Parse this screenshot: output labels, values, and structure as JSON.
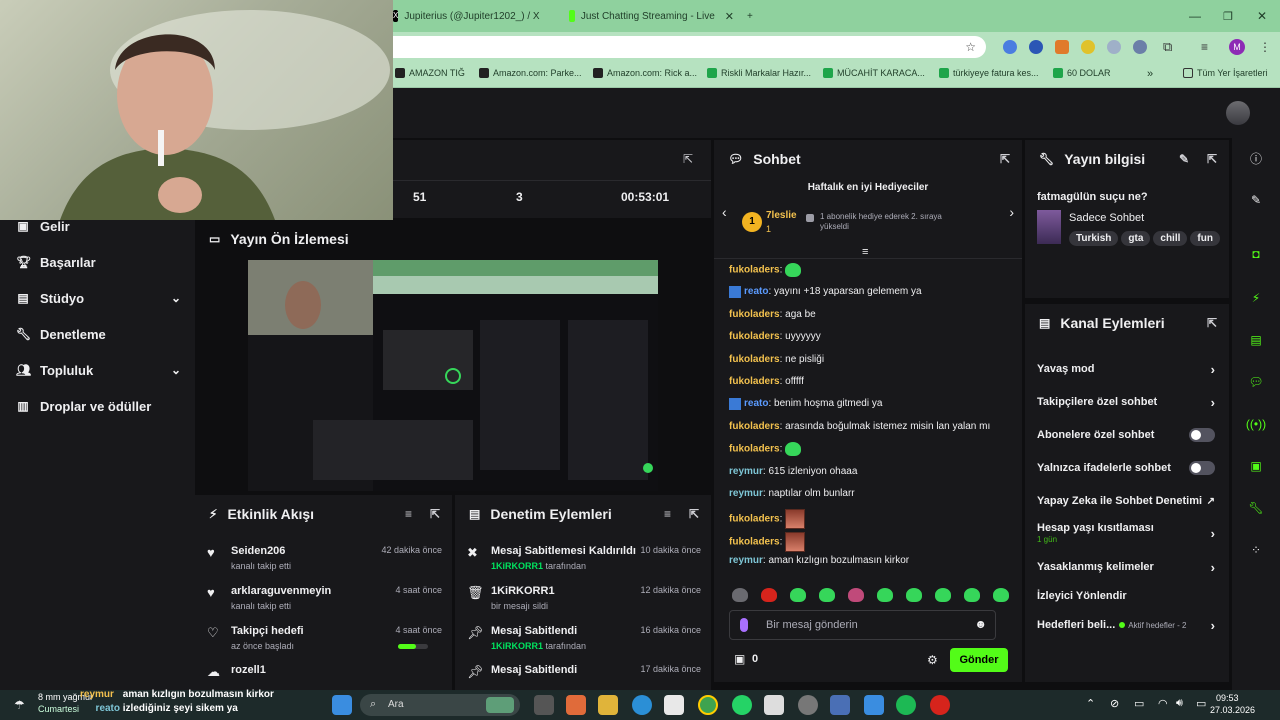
{
  "browser": {
    "tabs": [
      {
        "label": "Jupiterius (@Jupiter1202_) / X",
        "icon": "x-logo-icon"
      },
      {
        "label": "Just Chatting Streaming - Live",
        "icon": "kick-logo-icon"
      }
    ],
    "bookmarks": [
      "AMAZON TIĞ",
      "Amazon.com: Parke...",
      "Amazon.com: Rick a...",
      "Riskli Markalar Hazır...",
      "MÜCAHİT KARACA...",
      "türkiyeye fatura kes...",
      "60 DOLAR"
    ],
    "all_bookmarks_label": "Tüm Yer İşaretleri",
    "profile_letter": "M"
  },
  "sidebar": {
    "items": [
      {
        "label": "Gelir",
        "icon": "revenue-icon"
      },
      {
        "label": "Başarılar",
        "icon": "trophy-icon"
      },
      {
        "label": "Stüdyo",
        "icon": "studio-icon",
        "expandable": true
      },
      {
        "label": "Denetleme",
        "icon": "wrench-icon"
      },
      {
        "label": "Topluluk",
        "icon": "community-icon",
        "expandable": true
      },
      {
        "label": "Droplar ve ödüller",
        "icon": "drops-icon"
      }
    ]
  },
  "stats": {
    "viewers": "51",
    "followers": "3",
    "uptime": "00:53:01"
  },
  "preview": {
    "title": "Yayın Ön İzlemesi"
  },
  "activity": {
    "title": "Etkinlik Akışı",
    "items": [
      {
        "name": "Seiden206",
        "sub": "kanalı takip etti",
        "time": "42 dakika önce",
        "icon": "heart-icon"
      },
      {
        "name": "arklaraguvenmeyin",
        "sub": "kanalı takip etti",
        "time": "4 saat önce",
        "icon": "heart-icon"
      },
      {
        "name": "Takipçi hedefi",
        "sub": "az önce başladı",
        "time": "4 saat önce",
        "icon": "heart-outline-icon"
      },
      {
        "name": "rozell1",
        "sub": "",
        "time": "4 saat önce",
        "icon": "cloud-icon"
      }
    ]
  },
  "moderation": {
    "title": "Denetim Eylemleri",
    "items": [
      {
        "name": "Mesaj Sabitlemesi Kaldırıldı",
        "by": "1KiRKORR1",
        "by_suffix": "tarafından",
        "time": "10 dakika önce",
        "icon": "unpin-icon"
      },
      {
        "name": "1KiRKORR1",
        "by": "",
        "by_suffix": "bir mesajı sildi",
        "time": "12 dakika önce",
        "icon": "trash-icon"
      },
      {
        "name": "Mesaj Sabitlendi",
        "by": "1KiRKORR1",
        "by_suffix": "tarafından",
        "time": "16 dakika önce",
        "icon": "pin-icon"
      },
      {
        "name": "Mesaj Sabitlendi",
        "by": "",
        "by_suffix": "",
        "time": "17 dakika önce",
        "icon": "pin-icon"
      }
    ]
  },
  "chat": {
    "title": "Sohbet",
    "gifters_title": "Haftalık en iyi Hediyeciler",
    "gifter": {
      "rank": "1",
      "name": "7leslie",
      "count": "1",
      "desc": "1 abonelik hediye ederek 2. sıraya yükseldi"
    },
    "messages": [
      {
        "user": "fukoladers",
        "text": "",
        "emote": "green"
      },
      {
        "user": "reato",
        "text": "yayını +18 yaparsan gelemem ya",
        "badge": true
      },
      {
        "user": "fukoladers",
        "text": "aga be"
      },
      {
        "user": "fukoladers",
        "text": "uyyyyyy"
      },
      {
        "user": "fukoladers",
        "text": "ne pisliği"
      },
      {
        "user": "fukoladers",
        "text": "offfff"
      },
      {
        "user": "reato",
        "text": "benim hoşma gitmedi ya",
        "badge": true
      },
      {
        "user": "fukoladers",
        "text": "arasında boğulmak istemez misin lan yalan mı"
      },
      {
        "user": "fukoladers",
        "text": "",
        "emote": "green"
      },
      {
        "user": "reymur",
        "text": "615 izleniyon ohaaa"
      },
      {
        "user": "reymur",
        "text": "naptılar olm bunlarr"
      },
      {
        "user": "fukoladers",
        "text": "",
        "emote": "photo"
      },
      {
        "user": "fukoladers",
        "text": "",
        "emote": "photo"
      },
      {
        "user": "reymur",
        "text": "aman kızlıgın bozulmasın kirkor"
      }
    ],
    "input_placeholder": "Bir mesaj gönderin",
    "points": "0",
    "send_label": "Gönder"
  },
  "stream_info": {
    "title": "Yayın bilgisi",
    "stream_title": "fatmagülün suçu ne?",
    "category": "Sadece Sohbet",
    "tags": [
      "Turkish",
      "gta",
      "chill",
      "fun"
    ]
  },
  "channel_actions": {
    "title": "Kanal Eylemleri",
    "items": [
      {
        "label": "Yavaş mod",
        "control": "chevron"
      },
      {
        "label": "Takipçilere özel sohbet",
        "control": "chevron"
      },
      {
        "label": "Abonelere özel sohbet",
        "control": "toggle"
      },
      {
        "label": "Yalnızca ifadelerle sohbet",
        "control": "toggle"
      },
      {
        "label": "Yapay Zeka ile Sohbet Denetimi",
        "control": "external"
      },
      {
        "label": "Hesap yaşı kısıtlaması",
        "control": "chevron",
        "sub": "1 gün"
      },
      {
        "label": "Yasaklanmış kelimeler",
        "control": "chevron"
      },
      {
        "label": "İzleyici Yönlendir",
        "control": "none"
      },
      {
        "label": "Hedefleri beli...",
        "control": "chevron",
        "status": "Aktif hedefler - 2"
      }
    ]
  },
  "overlay_chat": [
    {
      "user": "reymur",
      "text": "aman kızlıgın bozulmasın kirkor"
    },
    {
      "user": "reato",
      "text": "izlediğiniz şeyi sikem ya"
    }
  ],
  "taskbar": {
    "weather": "8 mm yağmur",
    "weather_sub": "Cumartesi",
    "search_placeholder": "Ara",
    "time": "09:53",
    "date": "27.03.2026"
  },
  "colors": {
    "accent": "#53fc18",
    "bg": "#0e0e10",
    "panel": "#18181b",
    "browser": "#8fd19e"
  }
}
